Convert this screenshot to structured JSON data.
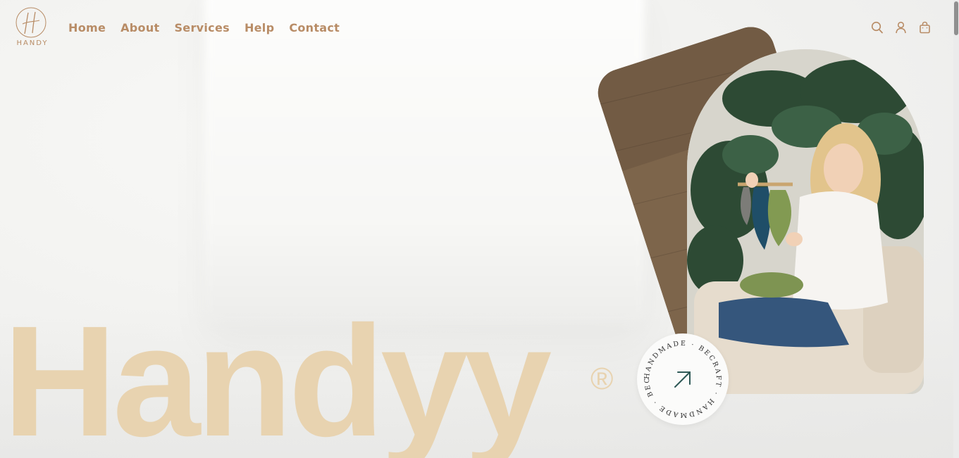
{
  "brand": {
    "logo_letter": "H",
    "logo_text": "HANDY"
  },
  "nav": {
    "items": [
      {
        "label": "Home"
      },
      {
        "label": "About"
      },
      {
        "label": "Services"
      },
      {
        "label": "Help"
      },
      {
        "label": "Contact"
      }
    ]
  },
  "header_icons": [
    "search-icon",
    "user-icon",
    "bag-icon"
  ],
  "hero": {
    "title": "Handyy",
    "registered_mark": "®"
  },
  "badge": {
    "ring_text": "HANDMADE · BECRAFT · HANDMADE · BECRAFT ·",
    "icon": "arrow-up-right-icon"
  },
  "colors": {
    "accent": "#b88c66",
    "hero_text": "#e8d3b0",
    "badge_icon": "#2f5a57"
  }
}
